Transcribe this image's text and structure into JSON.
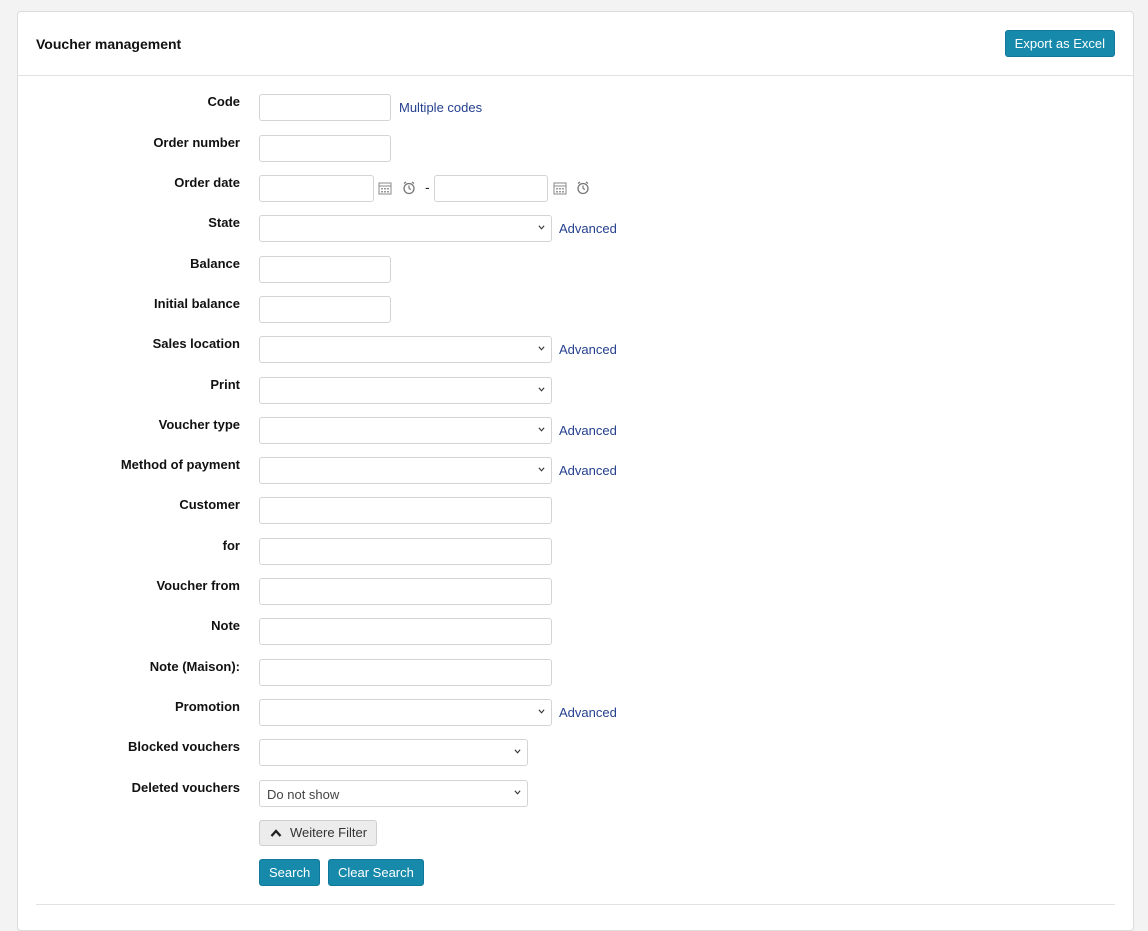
{
  "header": {
    "title": "Voucher management",
    "export_label": "Export as Excel"
  },
  "form": {
    "code_label": "Code",
    "multiple_codes": "Multiple codes",
    "order_number_label": "Order number",
    "order_date_label": "Order date",
    "date_separator": "-",
    "state_label": "State",
    "balance_label": "Balance",
    "initial_balance_label": "Initial balance",
    "sales_location_label": "Sales location",
    "print_label": "Print",
    "voucher_type_label": "Voucher type",
    "method_of_payment_label": "Method of payment",
    "customer_label": "Customer",
    "for_label": "for",
    "voucher_from_label": "Voucher from",
    "note_label": "Note",
    "note_maison_label": "Note (Maison):",
    "promotion_label": "Promotion",
    "blocked_vouchers_label": "Blocked vouchers",
    "deleted_vouchers_label": "Deleted vouchers",
    "deleted_vouchers_value": "Do not show",
    "advanced_label": "Advanced"
  },
  "actions": {
    "more_filters_label": "Weitere Filter",
    "search_label": "Search",
    "clear_search_label": "Clear Search"
  },
  "icons": {
    "calendar": "calendar-icon",
    "clock": "clock-icon",
    "chevron": "chevron-down-icon",
    "chevron_up": "chevron-up-icon"
  },
  "colors": {
    "primary_button": "#178aac",
    "link": "#25408f"
  }
}
